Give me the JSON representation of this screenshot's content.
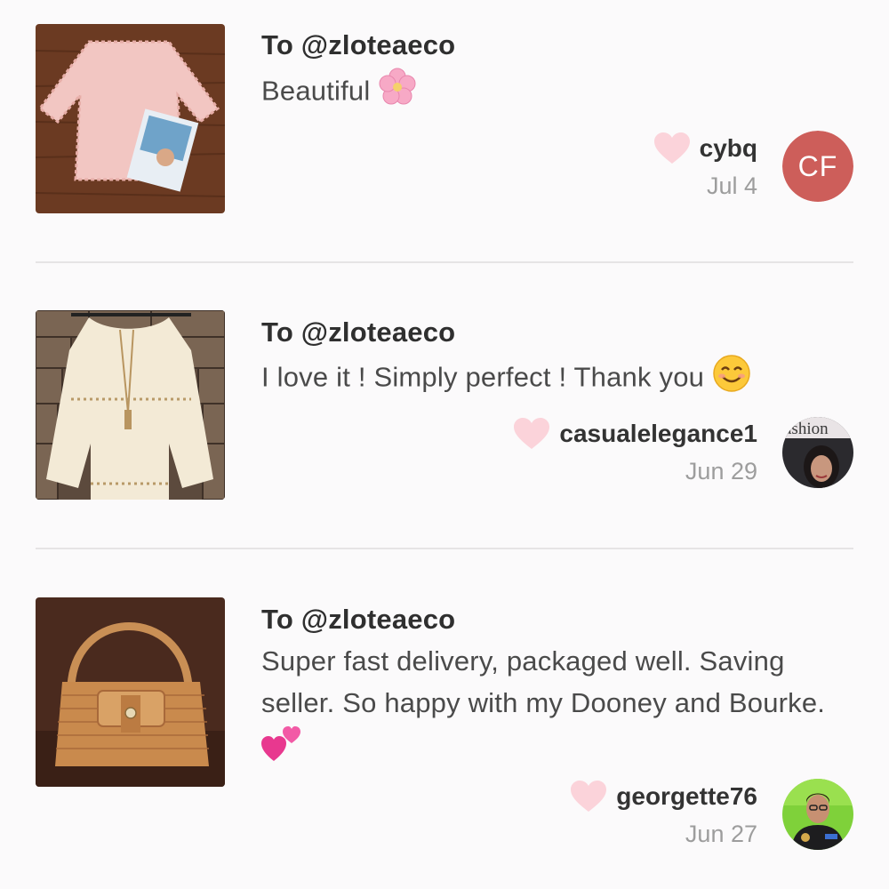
{
  "reviews": [
    {
      "to": "To @zloteaeco",
      "message": "Beautiful",
      "message_emoji": "cherry-blossom-emoji",
      "username": "cybq",
      "date": "Jul 4",
      "avatar_initials": "CF",
      "avatar_color": "#cd5e5a",
      "item": "pink lace top photo"
    },
    {
      "to": "To @zloteaeco",
      "message": "I love it ! Simply perfect ! Thank you",
      "message_emoji": "smiling-face-emoji",
      "username": "casualelegance1",
      "date": "Jun 29",
      "avatar_text": "ashion",
      "item": "cream bell-sleeve top photo"
    },
    {
      "to": "To @zloteaeco",
      "message": "Super fast delivery, packaged well. Saving seller. So happy with my Dooney and Bourke.",
      "message_emoji": "two-hearts-emoji",
      "username": "georgette76",
      "date": "Jun 27",
      "item": "snakeskin handbag photo"
    }
  ],
  "colors": {
    "heart": "#fbd3da",
    "divider": "#e6e4e5",
    "background": "#fbfafb"
  }
}
